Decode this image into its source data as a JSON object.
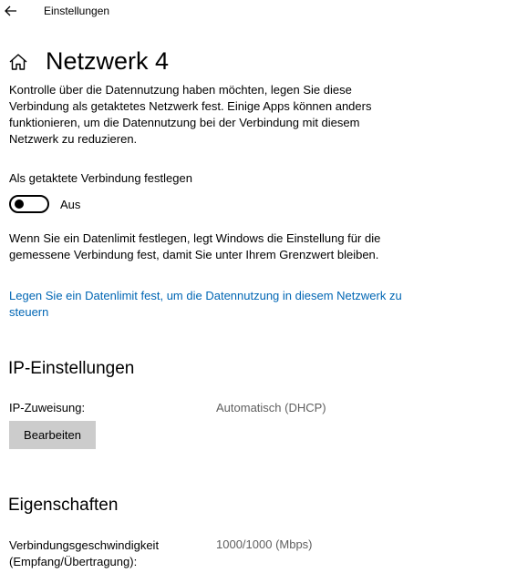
{
  "app": {
    "title": "Einstellungen"
  },
  "page": {
    "title": "Netzwerk 4"
  },
  "metered": {
    "description": "Kontrolle über die Datennutzung haben möchten, legen Sie diese Verbindung als getaktetes Netzwerk fest. Einige Apps können anders funktionieren, um die Datennutzung bei der Verbindung mit diesem Netzwerk zu reduzieren.",
    "toggle_label": "Als getaktete Verbindung festlegen",
    "toggle_state": "Aus",
    "toggle_on": false,
    "limit_description": "Wenn Sie ein Datenlimit festlegen, legt Windows die Einstellung für die gemessene Verbindung fest, damit Sie unter Ihrem Grenzwert bleiben.",
    "limit_link": "Legen Sie ein Datenlimit fest, um die Datennutzung in diesem Netzwerk zu steuern"
  },
  "ip_settings": {
    "heading": "IP-Einstellungen",
    "assignment_label": "IP-Zuweisung:",
    "assignment_value": "Automatisch (DHCP)",
    "edit_button": "Bearbeiten"
  },
  "properties": {
    "heading": "Eigenschaften",
    "speed_label": "Verbindungsgeschwindigkeit (Empfang/Übertragung):",
    "speed_value": "1000/1000 (Mbps)"
  },
  "icons": {
    "back": "back-arrow-icon",
    "home": "home-icon"
  },
  "colors": {
    "link": "#0066b4",
    "button_bg": "#cccccc",
    "secondary_text": "#5f5f5f"
  }
}
